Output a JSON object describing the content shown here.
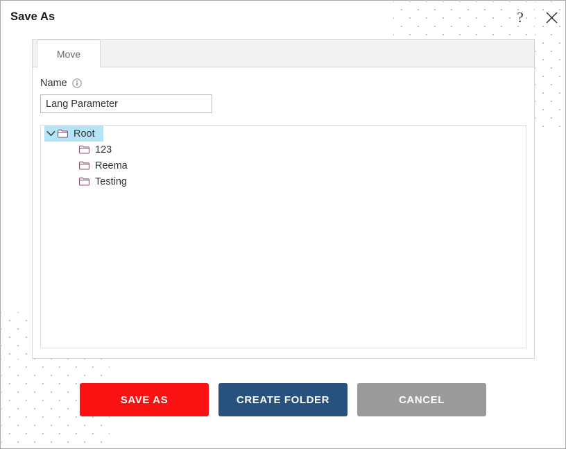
{
  "dialog": {
    "title": "Save As",
    "help_icon": "question-mark-icon",
    "close_icon": "close-icon"
  },
  "tabs": [
    {
      "label": "Move",
      "active": true
    }
  ],
  "form": {
    "name_label": "Name",
    "info_icon": "info-icon",
    "name_value": "Lang Parameter",
    "name_placeholder": ""
  },
  "tree": {
    "nodes": [
      {
        "label": "Root",
        "depth": 0,
        "expanded": true,
        "selected": true,
        "icon": "folder-icon",
        "chevron": "chevron-down-icon"
      },
      {
        "label": "123",
        "depth": 1,
        "expanded": false,
        "selected": false,
        "icon": "folder-icon",
        "chevron": ""
      },
      {
        "label": "Reema",
        "depth": 1,
        "expanded": false,
        "selected": false,
        "icon": "folder-icon",
        "chevron": ""
      },
      {
        "label": "Testing",
        "depth": 1,
        "expanded": false,
        "selected": false,
        "icon": "folder-icon",
        "chevron": ""
      }
    ]
  },
  "buttons": {
    "save_as": "SAVE AS",
    "create_folder": "CREATE FOLDER",
    "cancel": "CANCEL"
  },
  "colors": {
    "save_as": "#fa1212",
    "create_folder": "#27527d",
    "cancel": "#9b9b9b",
    "selection": "#b4e4f6",
    "folder_outline": "#7b3f5e",
    "dot_pattern": "#b9c0e8"
  }
}
